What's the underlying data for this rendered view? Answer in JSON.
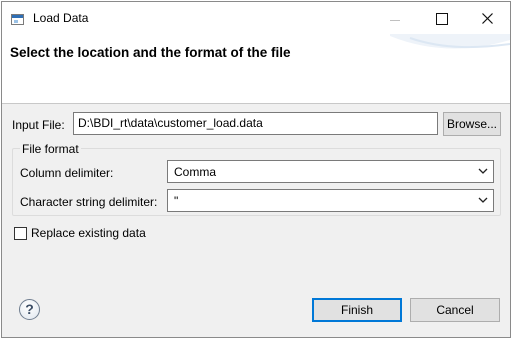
{
  "window": {
    "title": "Load Data",
    "controls": {
      "minimize": "minimize",
      "maximize": "maximize",
      "close": "close"
    }
  },
  "header": {
    "title": "Select the location and the format of the file"
  },
  "input_file": {
    "label": "Input File:",
    "value": "D:\\BDI_rt\\data\\customer_load.data",
    "browse_label": "Browse..."
  },
  "file_format": {
    "group_title": "File format",
    "column_delimiter": {
      "label": "Column delimiter:",
      "value": "Comma"
    },
    "string_delimiter": {
      "label": "Character string delimiter:",
      "value": "\""
    }
  },
  "replace": {
    "label": "Replace existing data",
    "checked": false
  },
  "footer": {
    "help_symbol": "?",
    "finish_label": "Finish",
    "cancel_label": "Cancel"
  },
  "colors": {
    "accent": "#0078d7",
    "panel": "#f0f0f0",
    "banner": "#ffffff"
  }
}
